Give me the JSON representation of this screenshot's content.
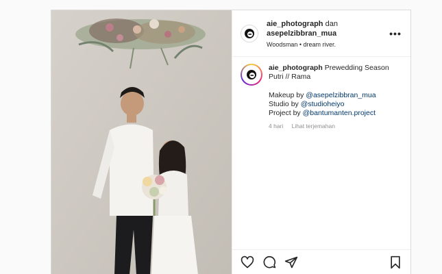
{
  "post": {
    "header": {
      "username1": "aie_photograph",
      "conjunction": "dan",
      "username2": "asepelzibbran_mua",
      "location": "Woodsman • dream river."
    },
    "caption": {
      "username": "aie_photograph",
      "title_line1": "Prewedding Season",
      "title_line2": "Putri // Rama",
      "makeup_label": "Makeup by",
      "makeup_mention": "@asepelzibbran_mua",
      "studio_label": "Studio by",
      "studio_mention": "@studioheiyo",
      "project_label": "Project by",
      "project_mention": "@bantumanten.project",
      "time": "4 hari",
      "translate": "Lihat terjemahan"
    },
    "icons": [
      "more-options-icon",
      "heart-icon",
      "comment-icon",
      "share-icon",
      "bookmark-icon"
    ]
  }
}
